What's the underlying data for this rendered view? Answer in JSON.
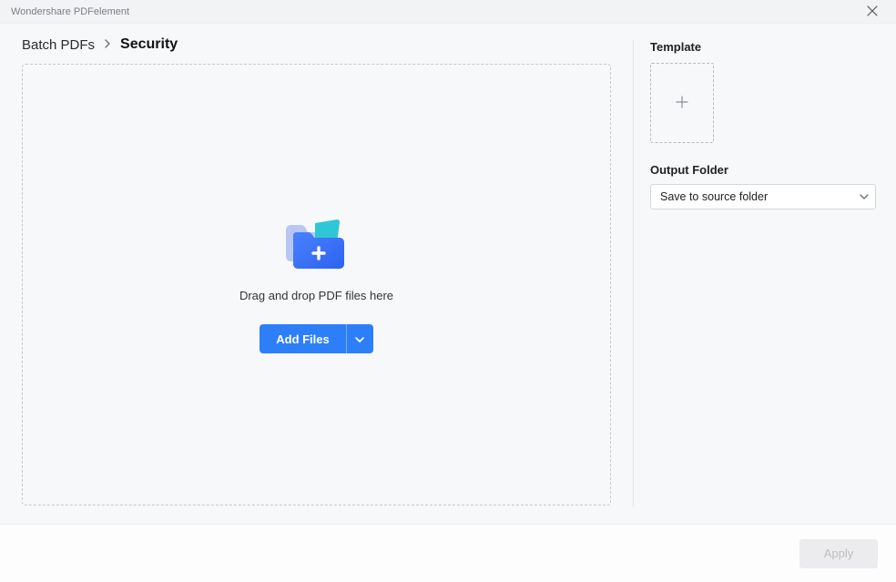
{
  "titlebar": {
    "app_name": "Wondershare PDFelement"
  },
  "breadcrumb": {
    "root": "Batch PDFs",
    "current": "Security"
  },
  "dropzone": {
    "hint": "Drag and drop PDF files here",
    "add_label": "Add Files"
  },
  "template": {
    "section_label": "Template"
  },
  "output": {
    "section_label": "Output Folder",
    "selected": "Save to source folder"
  },
  "footer": {
    "apply_label": "Apply"
  }
}
